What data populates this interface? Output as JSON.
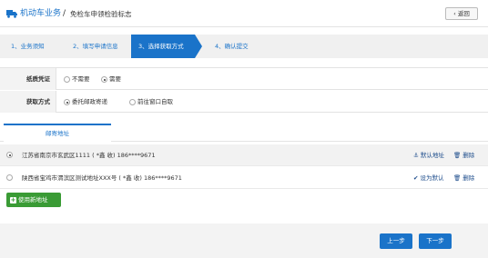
{
  "header": {
    "title": "机动车业务",
    "separator": "/",
    "subtitle": "免检车申领检验标志",
    "back_label": "返回",
    "back_icon": "chevron-left-icon",
    "title_icon": "truck-icon"
  },
  "steps": [
    {
      "label": "1、业务须知",
      "active": false
    },
    {
      "label": "2、填写申请信息",
      "active": false
    },
    {
      "label": "3、选择获取方式",
      "active": true
    },
    {
      "label": "4、确认提交",
      "active": false
    }
  ],
  "form": {
    "voucher": {
      "label": "纸质凭证",
      "options": [
        "不需要",
        "需要"
      ],
      "selected": "需要"
    },
    "method": {
      "label": "获取方式",
      "options": [
        "委托邮政寄递",
        "前往窗口自取"
      ],
      "selected": "委托邮政寄递"
    }
  },
  "tabs": {
    "mail_address": "邮寄地址"
  },
  "addresses": [
    {
      "text": "江苏省南京市玄武区1111 ( *鑫 收)  186****9671",
      "selected": true,
      "primary_action": "默认地址",
      "primary_icon": "anchor-icon",
      "delete_label": "删除",
      "delete_icon": "trash-icon"
    },
    {
      "text": "陕西省宝鸡市渭滨区测试地址XXX号 ( *鑫 收)  186****9671",
      "selected": false,
      "primary_action": "设为默认",
      "primary_icon": "check-icon",
      "delete_label": "删除",
      "delete_icon": "trash-icon"
    }
  ],
  "use_new_label": "使用新地址",
  "footer": {
    "prev_label": "上一步",
    "next_label": "下一步"
  },
  "colors": {
    "primary": "#1a73c9",
    "green": "#3a9b35",
    "panel": "#f3f3f3"
  }
}
